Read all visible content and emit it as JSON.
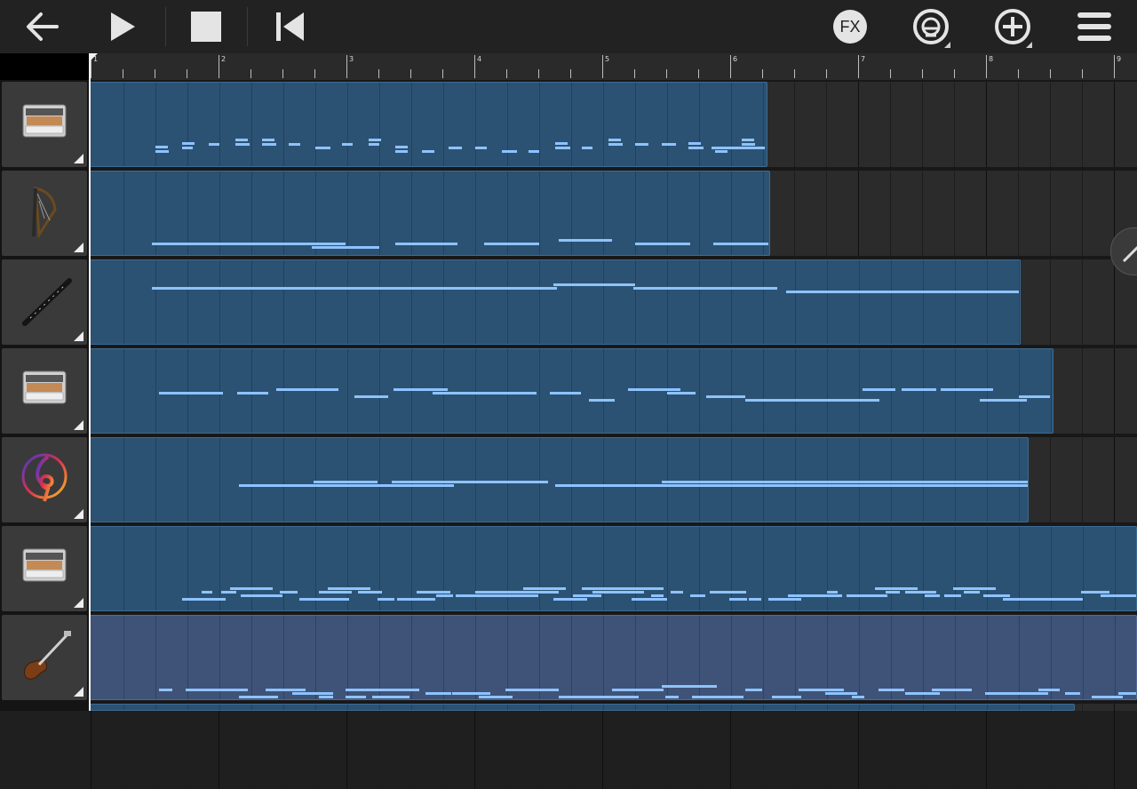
{
  "toolbar": {
    "fx_label": "FX",
    "icons": [
      "back-arrow-icon",
      "play-icon",
      "stop-icon",
      "skip-to-start-icon",
      "fx-icon",
      "mixer-knob-icon",
      "add-icon",
      "menu-icon"
    ]
  },
  "ruler": {
    "bars": [
      "1",
      "2",
      "3",
      "4",
      "5",
      "6",
      "7",
      "8",
      "9"
    ]
  },
  "colors": {
    "region": "#2c5273",
    "region_alt": "#3f5378",
    "note": "#8ec3ff",
    "toolbar": "#222222"
  },
  "tracks": [
    {
      "instrument": "piano-icon"
    },
    {
      "instrument": "harp-icon"
    },
    {
      "instrument": "clarinet-icon"
    },
    {
      "instrument": "piano-icon"
    },
    {
      "instrument": "treble-clef-logo-icon"
    },
    {
      "instrument": "piano-icon"
    },
    {
      "instrument": "bass-guitar-icon"
    }
  ]
}
